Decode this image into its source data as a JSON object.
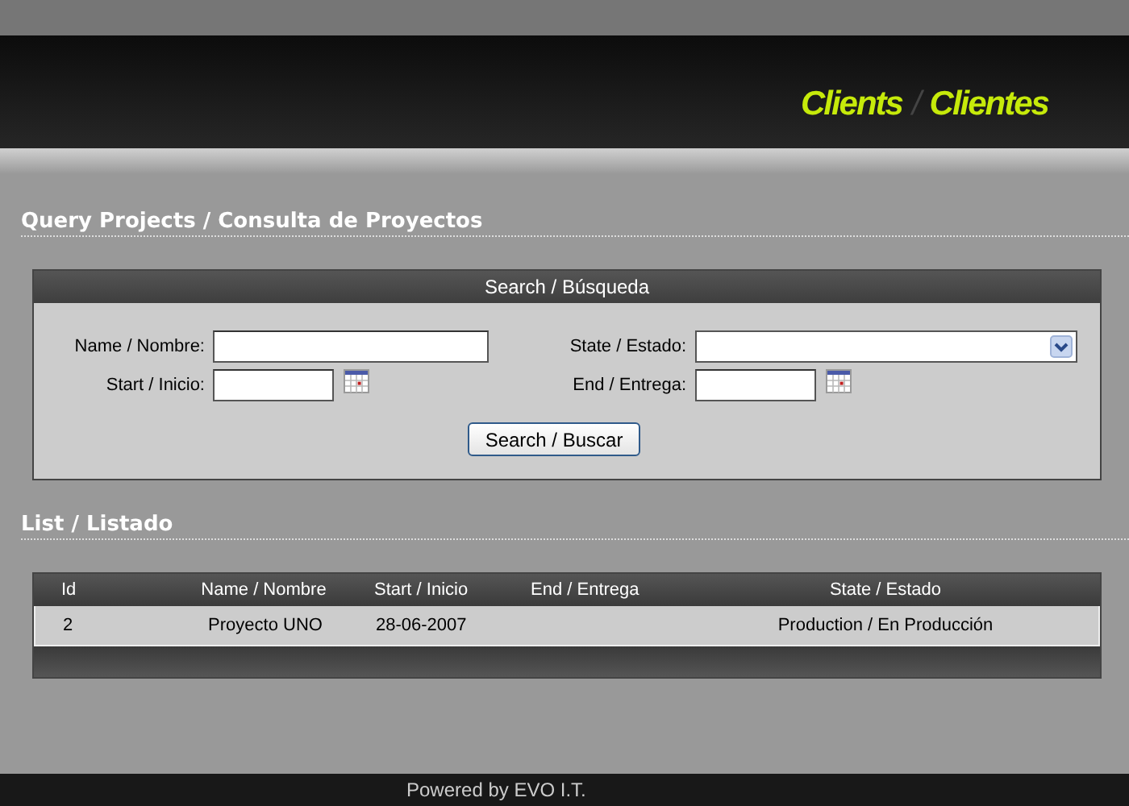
{
  "header": {
    "title_en": "Clients",
    "separator": "/",
    "title_es": "Clientes"
  },
  "query_heading": "Query Projects / Consulta de Proyectos",
  "search": {
    "title": "Search / Búsqueda",
    "fields": [
      {
        "label": "Name / Nombre:",
        "kind": "text"
      },
      {
        "label": "State / Estado:",
        "kind": "select"
      },
      {
        "label": "Start / Inicio:",
        "kind": "date"
      },
      {
        "label": "End / Entrega:",
        "kind": "date"
      }
    ],
    "button": "Search / Buscar"
  },
  "list_heading": "List / Listado",
  "table": {
    "columns": [
      "Id",
      "Name / Nombre",
      "Start / Inicio",
      "End / Entrega",
      "State / Estado"
    ],
    "rows": [
      [
        "2",
        "Proyecto UNO",
        "28-06-2007",
        "",
        "Production / En Producción"
      ]
    ]
  },
  "footer": "Powered by EVO I.T."
}
